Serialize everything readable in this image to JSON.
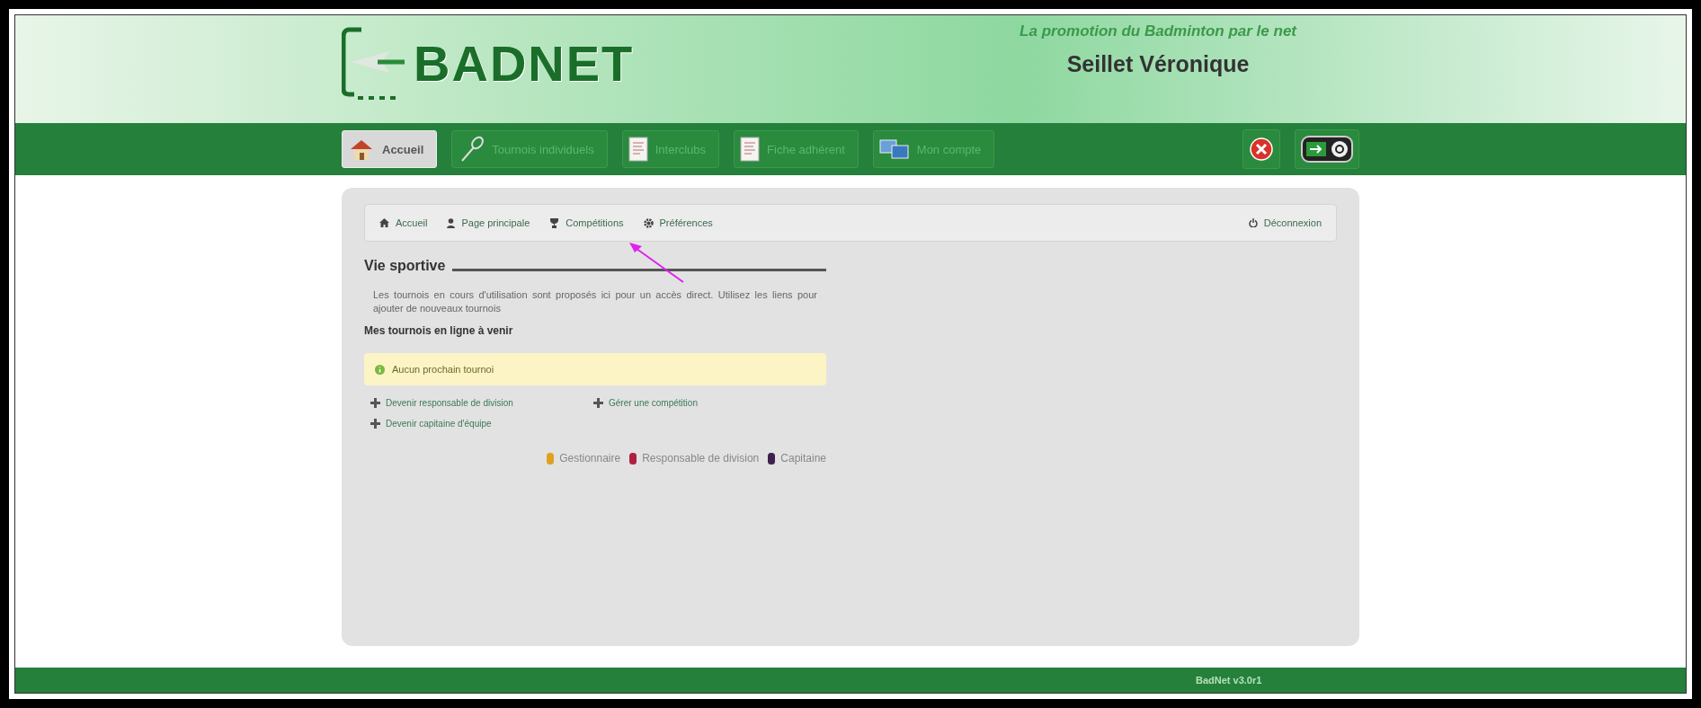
{
  "header": {
    "logo": "BADNET",
    "tagline": "La promotion du Badminton par le net",
    "user": "Seillet Véronique"
  },
  "nav": [
    {
      "label": "Accueil",
      "kind": "house",
      "selected": true
    },
    {
      "label": "Tournois individuels",
      "kind": "racket",
      "selected": false
    },
    {
      "label": "Interclubs",
      "kind": "sheet",
      "selected": false
    },
    {
      "label": "Fiche adhérent",
      "kind": "sheet",
      "selected": false
    },
    {
      "label": "Mon compte",
      "kind": "screens",
      "selected": false
    }
  ],
  "breadcrumb": [
    {
      "label": "Accueil",
      "kind": "home"
    },
    {
      "label": "Page principale",
      "kind": "user"
    },
    {
      "label": "Compétitions",
      "kind": "trophy"
    },
    {
      "label": "Préférences",
      "kind": "gear"
    }
  ],
  "logout": "Déconnexion",
  "section": {
    "title": "Vie sportive",
    "intro": "Les tournois en cours d'utilisation sont proposés ici pour un accès direct. Utilisez les liens pour ajouter de nouveaux tournois",
    "subtitle": "Mes tournois en ligne à venir",
    "notice": "Aucun prochain tournoi"
  },
  "actions": [
    "Devenir responsable de division",
    "Gérer une compétition",
    "Devenir capitaine d'équipe"
  ],
  "legend": [
    {
      "label": "Gestionnaire",
      "color": "#e0a020"
    },
    {
      "label": "Responsable de division",
      "color": "#b02040"
    },
    {
      "label": "Capitaine",
      "color": "#402050"
    }
  ],
  "footer": "BadNet v3.0r1"
}
